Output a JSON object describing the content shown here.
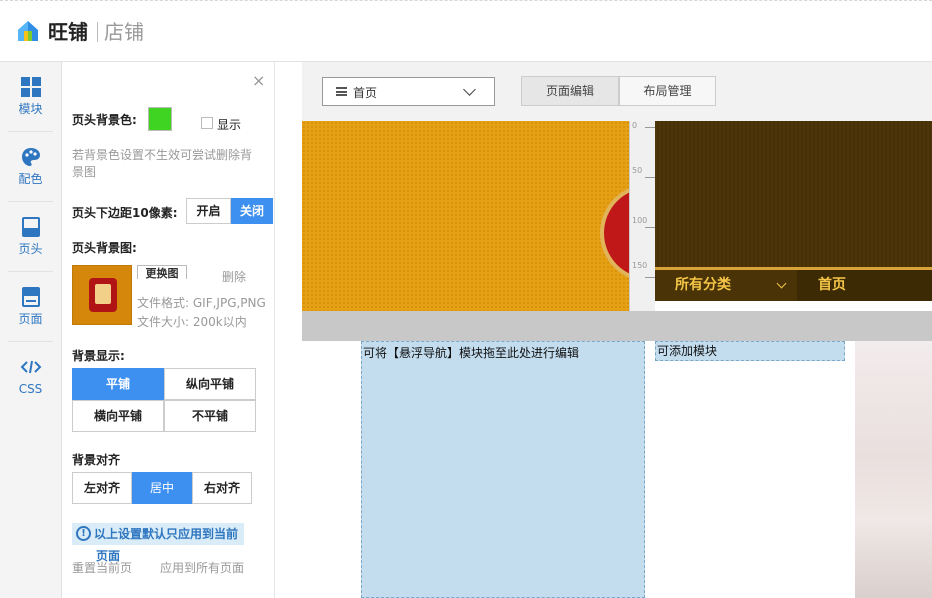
{
  "brand": {
    "name": "旺铺",
    "sub": "店铺"
  },
  "leftnav": [
    {
      "label": "模块",
      "icon": "grid-icon"
    },
    {
      "label": "配色",
      "icon": "palette-icon"
    },
    {
      "label": "页头",
      "icon": "header-icon",
      "active": true
    },
    {
      "label": "页面",
      "icon": "page-icon"
    },
    {
      "label": "CSS",
      "icon": "code-icon"
    }
  ],
  "panel": {
    "close": "×",
    "bg_color_label": "页头背景色:",
    "bg_color_value": "#3fd421",
    "show_label": "显示",
    "hint": "若背景色设置不生效可尝试删除背景图",
    "margin_label": "页头下边距10像素:",
    "margin_on": "开启",
    "margin_off": "关闭",
    "bg_image_label": "页头背景图:",
    "replace_label": "更换图",
    "delete_label": "删除",
    "file_format": "文件格式: GIF,JPG,PNG",
    "file_size": "文件大小: 200k以内",
    "display_label": "背景显示:",
    "display_options": [
      "平铺",
      "纵向平铺",
      "横向平铺",
      "不平铺"
    ],
    "display_selected": "平铺",
    "align_label": "背景对齐",
    "align_options": [
      "左对齐",
      "居中",
      "右对齐"
    ],
    "align_selected": "居中",
    "notice_line1": "以上设置默认只应用到当前",
    "notice_line2": "页面",
    "reset_link": "重置当前页",
    "apply_all_link": "应用到所有页面"
  },
  "canvas": {
    "page_select": "首页",
    "tabs": [
      "页面编辑",
      "布局管理"
    ],
    "active_tab": "页面编辑",
    "ruler_marks": [
      "0",
      "50",
      "100",
      "150"
    ],
    "nav_category": "所有分类",
    "nav_home": "首页",
    "dropzone_text": "可将【悬浮导航】模块拖至此处进行编辑",
    "addzone_text": "可添加模块"
  }
}
